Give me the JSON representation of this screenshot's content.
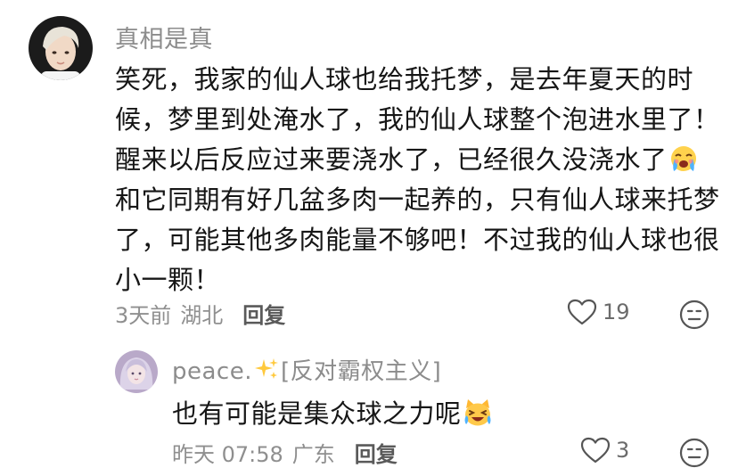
{
  "comment": {
    "username": "真相是真",
    "text_part1": "笑死，我家的仙人球也给我托梦，是去年夏天的时候，梦里到处淹水了，我的仙人球整个泡进水里了！醒来以后反应过来要浇水了，已经很久没浇水了",
    "emoji1": "crying-face",
    "text_part2": "和它同期有好几盆多肉一起养的，只有仙人球来托梦了，可能其他多肉能量不够吧！不过我的仙人球也很小一颗！",
    "time": "3天前",
    "location": "湖北",
    "reply_label": "回复",
    "like_count": "19"
  },
  "reply": {
    "username_part1": "peace.",
    "username_icon": "sparkles",
    "username_part2": "[反对霸权主义]",
    "text": "也有可能是集众球之力呢",
    "emoji": "laughing-cat",
    "time": "昨天 07:58",
    "location": "广东",
    "reply_label": "回复",
    "like_count": "3"
  },
  "colors": {
    "text": "#161616",
    "meta": "#8f8f8f",
    "username": "#8c8c8c"
  }
}
